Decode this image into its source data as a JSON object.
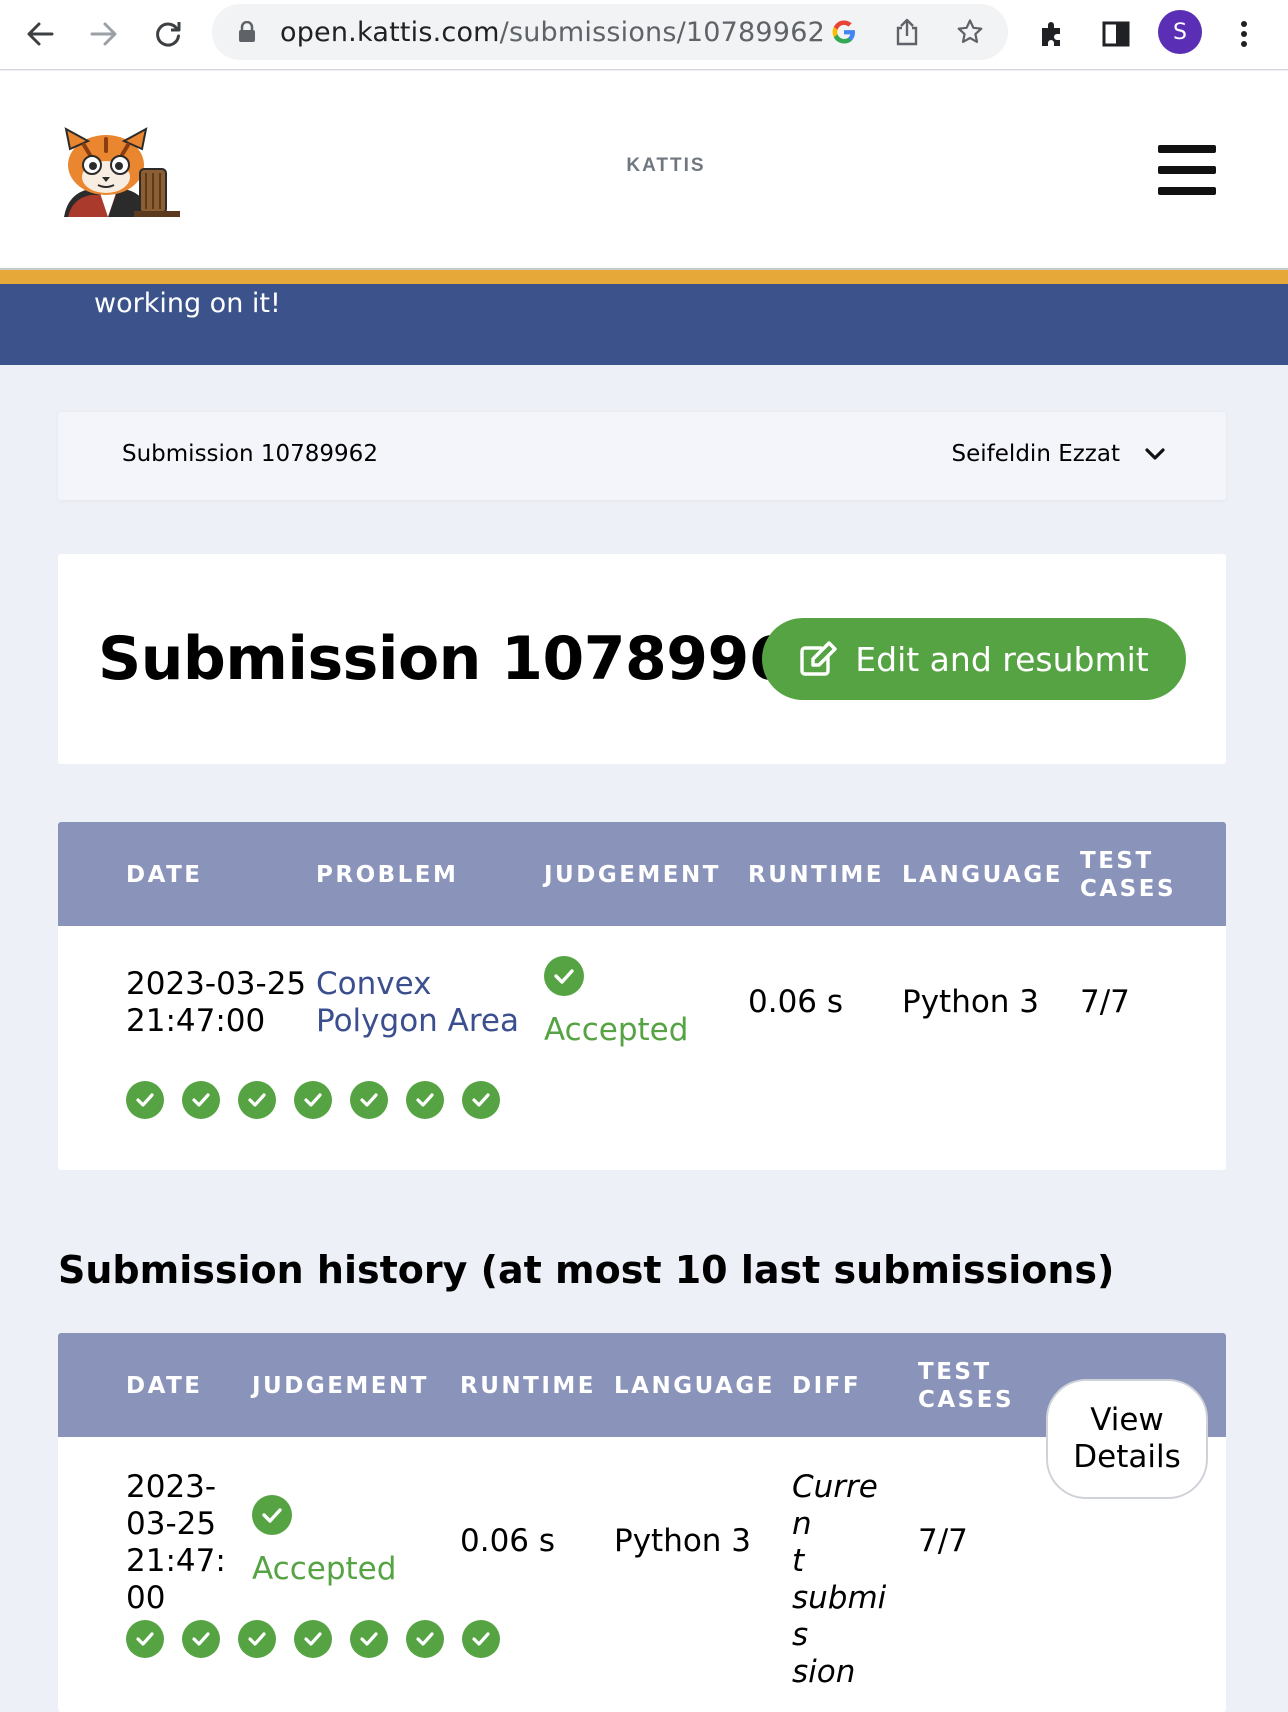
{
  "browser": {
    "url_host": "open.kattis.com",
    "url_path": "/submissions/10789962",
    "profile_initial": "S"
  },
  "header": {
    "brand": "KATTIS"
  },
  "notice": {
    "text": "working on it!"
  },
  "breadcrumb": {
    "title": "Submission 10789962",
    "user": "Seifeldin Ezzat"
  },
  "main": {
    "title": "Submission 10789962",
    "edit_button": "Edit and resubmit"
  },
  "submission_table": {
    "headers": {
      "date": "DATE",
      "problem": "PROBLEM",
      "judgement": "JUDGEMENT",
      "runtime": "RUNTIME",
      "language": "LANGUAGE",
      "test_cases_1": "TEST",
      "test_cases_2": "CASES"
    },
    "row": {
      "date_line1": "2023-03-25",
      "date_line2": "21:47:00",
      "problem_line1": "Convex",
      "problem_line2": "Polygon Area",
      "judgement": "Accepted",
      "runtime": "0.06 s",
      "language": "Python 3",
      "test_cases": "7/7",
      "passed_test_count": 7
    }
  },
  "history": {
    "title": "Submission history (at most 10 last submissions)",
    "headers": {
      "date": "DATE",
      "judgement": "JUDGEMENT",
      "runtime": "RUNTIME",
      "language": "LANGUAGE",
      "diff": "DIFF",
      "test_cases_1": "TEST",
      "test_cases_2": "CASES"
    },
    "rows": [
      {
        "date_line1": "2023-",
        "date_line2": "03-25",
        "date_line3": "21:47:",
        "date_line4": "00",
        "judgement": "Accepted",
        "runtime": "0.06 s",
        "language": "Python 3",
        "diff_line1": "Curren",
        "diff_line2": "t",
        "diff_line3": "submis",
        "diff_line4": "sion",
        "test_cases": "7/7",
        "view_line1": "View",
        "view_line2": "Details",
        "passed_test_count": 7
      }
    ]
  },
  "colors": {
    "accent_green": "#55a343",
    "notice_blue": "#3b528a",
    "gold": "#e7a83a",
    "table_header": "#8a93b9",
    "link_blue": "#3b4f8f"
  }
}
